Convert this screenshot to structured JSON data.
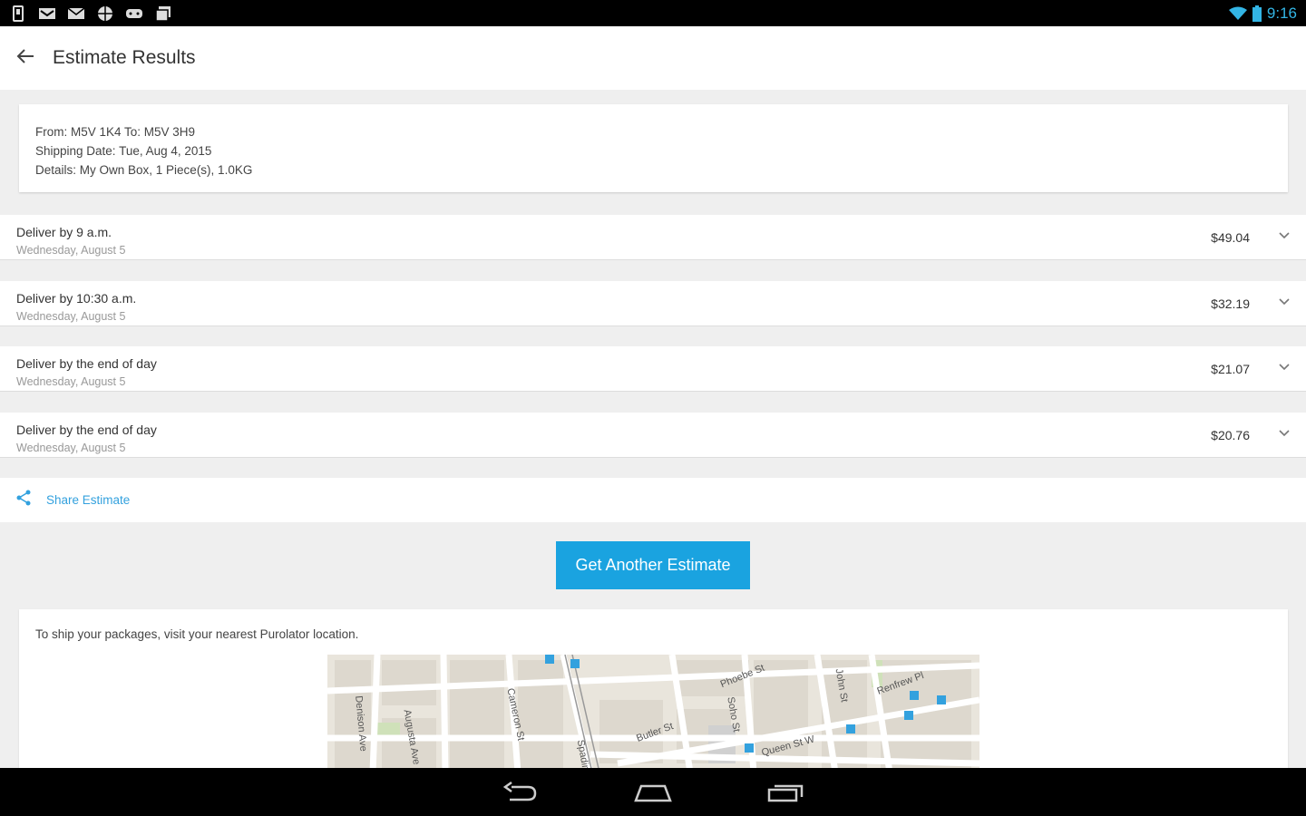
{
  "status_bar": {
    "time": "9:16"
  },
  "app_bar": {
    "title": "Estimate Results"
  },
  "summary": {
    "route": "From: M5V 1K4 To: M5V 3H9",
    "shipping_date": "Shipping Date: Tue, Aug 4, 2015",
    "details": "Details: My Own Box, 1 Piece(s), 1.0KG"
  },
  "options": [
    {
      "title": "Deliver by 9 a.m.",
      "date": "Wednesday, August 5",
      "price": "$49.04"
    },
    {
      "title": "Deliver by 10:30 a.m.",
      "date": "Wednesday, August 5",
      "price": "$32.19"
    },
    {
      "title": "Deliver by the end of day",
      "date": "Wednesday, August 5",
      "price": "$21.07"
    },
    {
      "title": "Deliver by the end of day",
      "date": "Wednesday, August 5",
      "price": "$20.76"
    }
  ],
  "share": {
    "label": "Share Estimate"
  },
  "cta": {
    "label": "Get Another Estimate"
  },
  "location": {
    "text": "To ship your packages, visit your nearest Purolator location.",
    "streets": [
      "Phoebe St",
      "Renfrew Pl",
      "John St",
      "Soho St",
      "Butler St",
      "Queen St W",
      "Cameron St",
      "Augusta Ave",
      "Denison Ave",
      "Spadina"
    ]
  },
  "colors": {
    "accent": "#1aa3e0",
    "link": "#33a1de",
    "status_icons": "#33b5e5"
  }
}
